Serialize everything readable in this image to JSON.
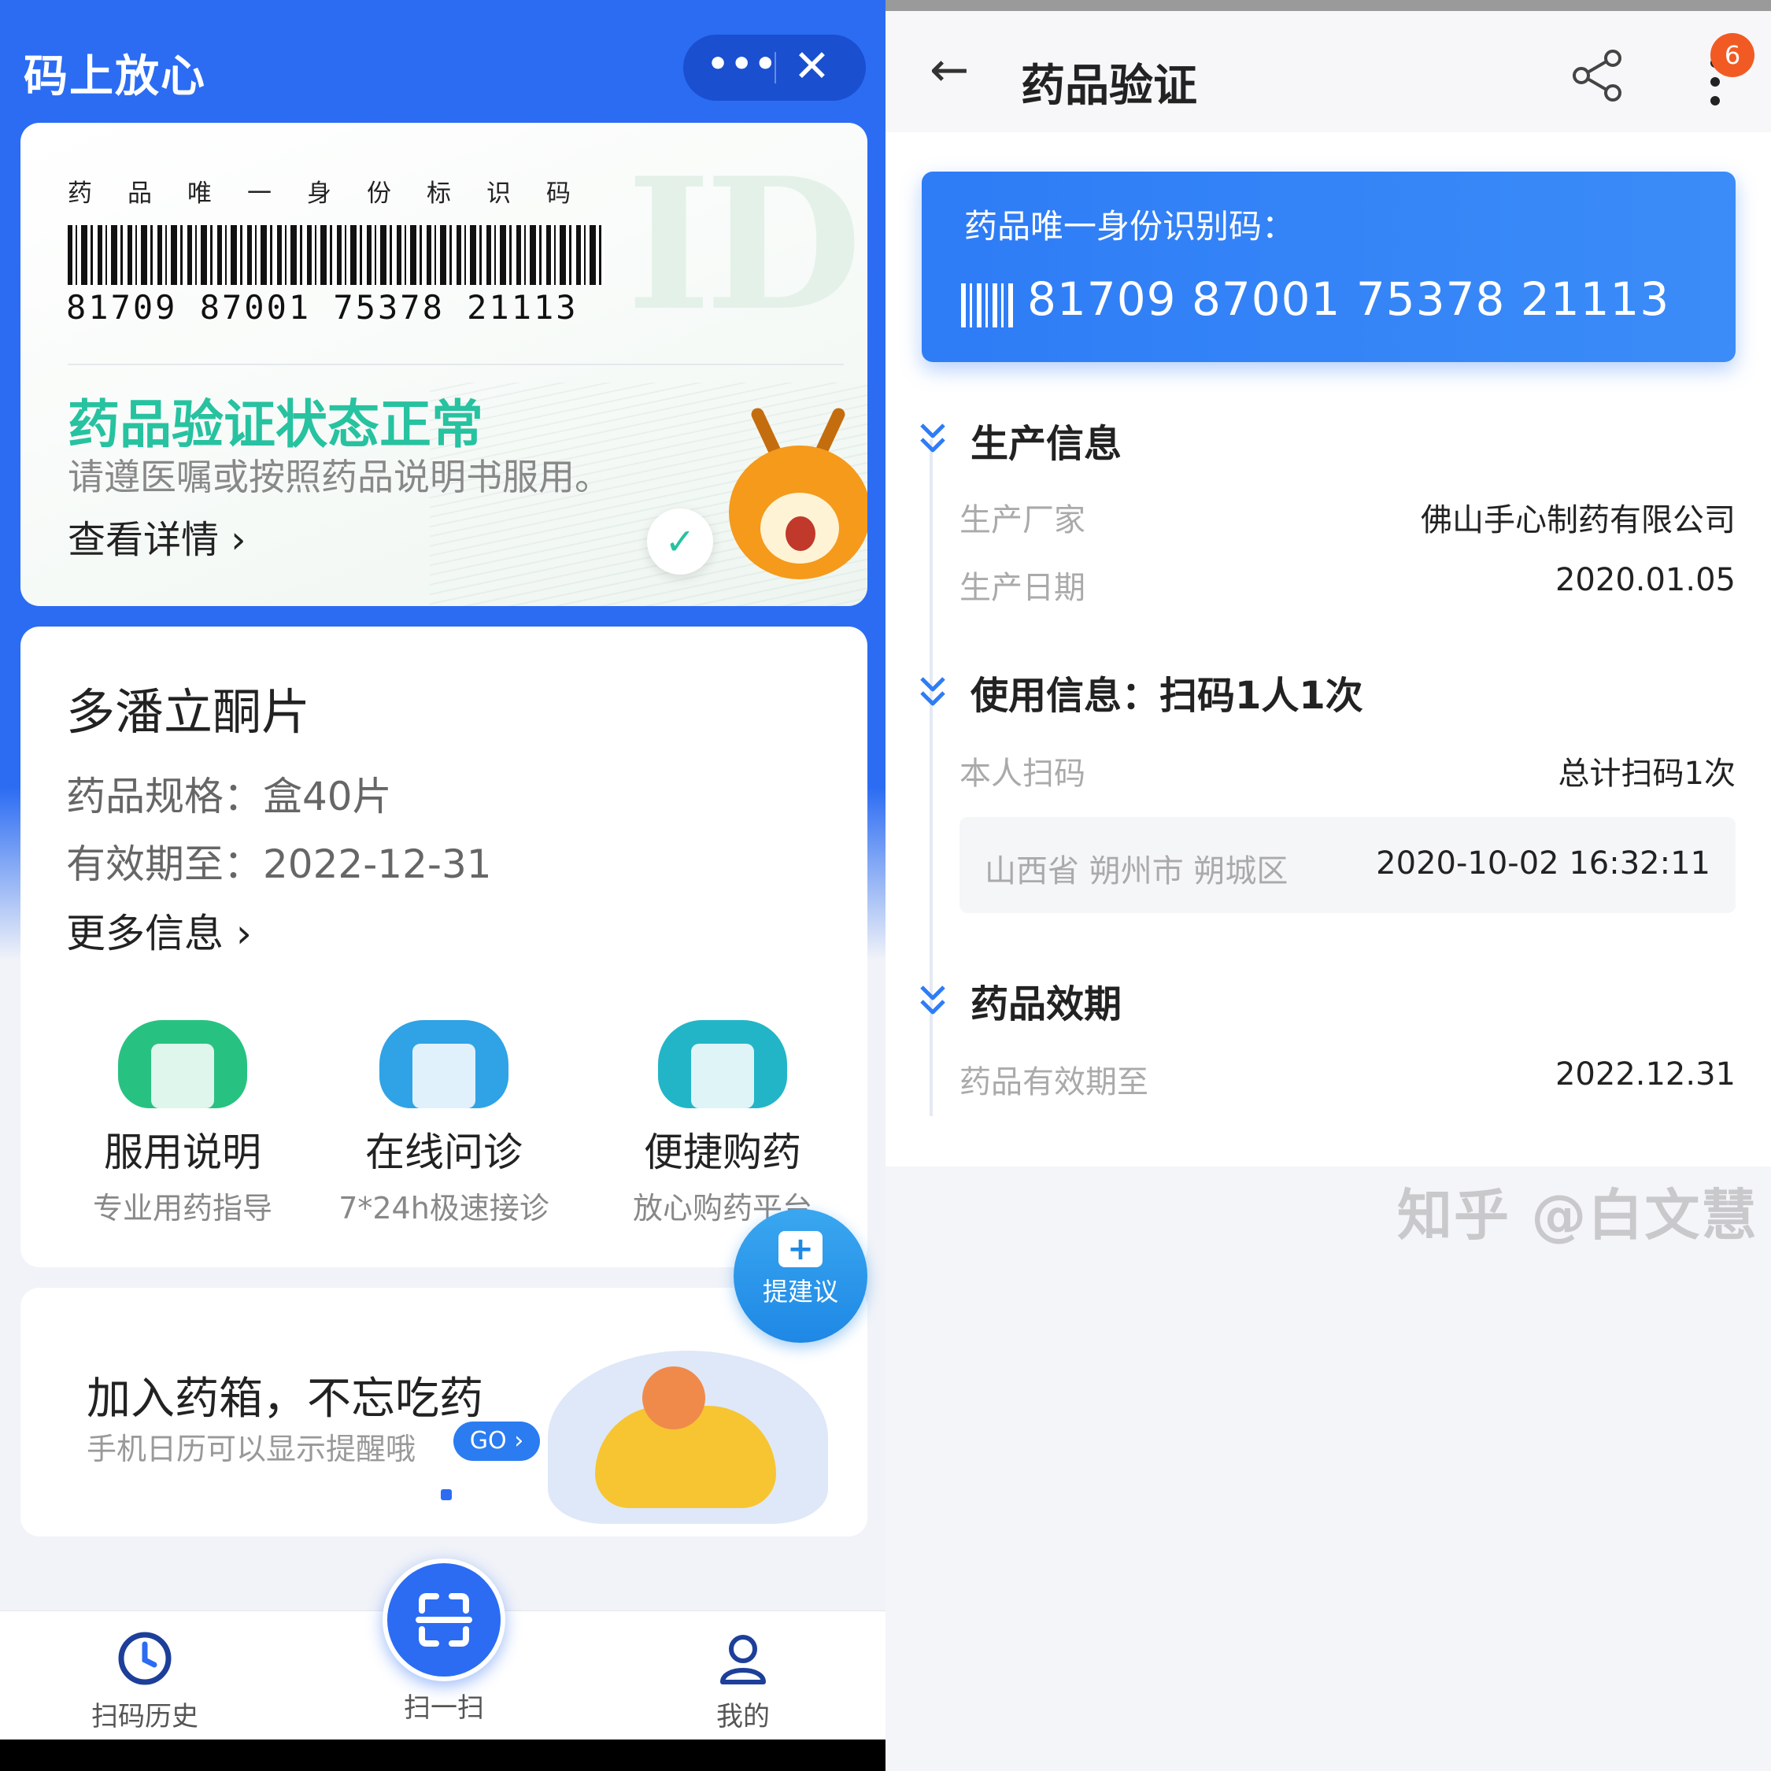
{
  "left": {
    "app_title": "码上放心",
    "capsule": {
      "more": "•••",
      "close": "✕"
    },
    "id_card": {
      "label": "药品唯一身份标识码",
      "code": "81709 87001 75378 21113",
      "watermark": "ID",
      "status_title": "药品验证状态正常",
      "status_sub": "请遵医嘱或按照药品说明书服用。",
      "detail_link": "查看详情 ›",
      "check": "✓"
    },
    "drug": {
      "name": "多潘立酮片",
      "spec": "药品规格：盒40片",
      "expiry": "有效期至：2022-12-31",
      "more_link": "更多信息 ›"
    },
    "services": [
      {
        "name": "服用说明",
        "desc": "专业用药指导",
        "icon": "document-icon",
        "color": "#27c281"
      },
      {
        "name": "在线问诊",
        "desc": "7*24h极速接诊",
        "icon": "doctor-icon",
        "color": "#2fa3e6"
      },
      {
        "name": "便捷购药",
        "desc": "放心购药平台",
        "icon": "medkit-icon",
        "color": "#22b5c8"
      }
    ],
    "suggest": {
      "plus": "+",
      "label": "提建议"
    },
    "medbox": {
      "title": "加入药箱，不忘吃药",
      "subtitle": "手机日历可以显示提醒哦",
      "go": "GO ›"
    },
    "tabs": [
      {
        "label": "扫码历史",
        "icon": "clock-icon"
      },
      {
        "label": "扫一扫",
        "icon": "scan-icon"
      },
      {
        "label": "我的",
        "icon": "user-icon"
      }
    ]
  },
  "right": {
    "back": "←",
    "title": "药品验证",
    "badge": "6",
    "id_card": {
      "label": "药品唯一身份识别码：",
      "code": "81709 87001 75378 21113"
    },
    "production": {
      "title": "生产信息",
      "manufacturer_k": "生产厂家",
      "manufacturer_v": "佛山手心制药有限公司",
      "date_k": "生产日期",
      "date_v": "2020.01.05"
    },
    "usage": {
      "title": "使用信息：扫码1人1次",
      "self_k": "本人扫码",
      "self_v": "总计扫码1次",
      "record_location": "山西省 朔州市 朔城区",
      "record_time": "2020-10-02 16:32:11"
    },
    "validity": {
      "title": "药品效期",
      "expiry_k": "药品有效期至",
      "expiry_v": "2022.12.31"
    },
    "section_icon": "»",
    "watermark": "知乎 @白文慧"
  }
}
